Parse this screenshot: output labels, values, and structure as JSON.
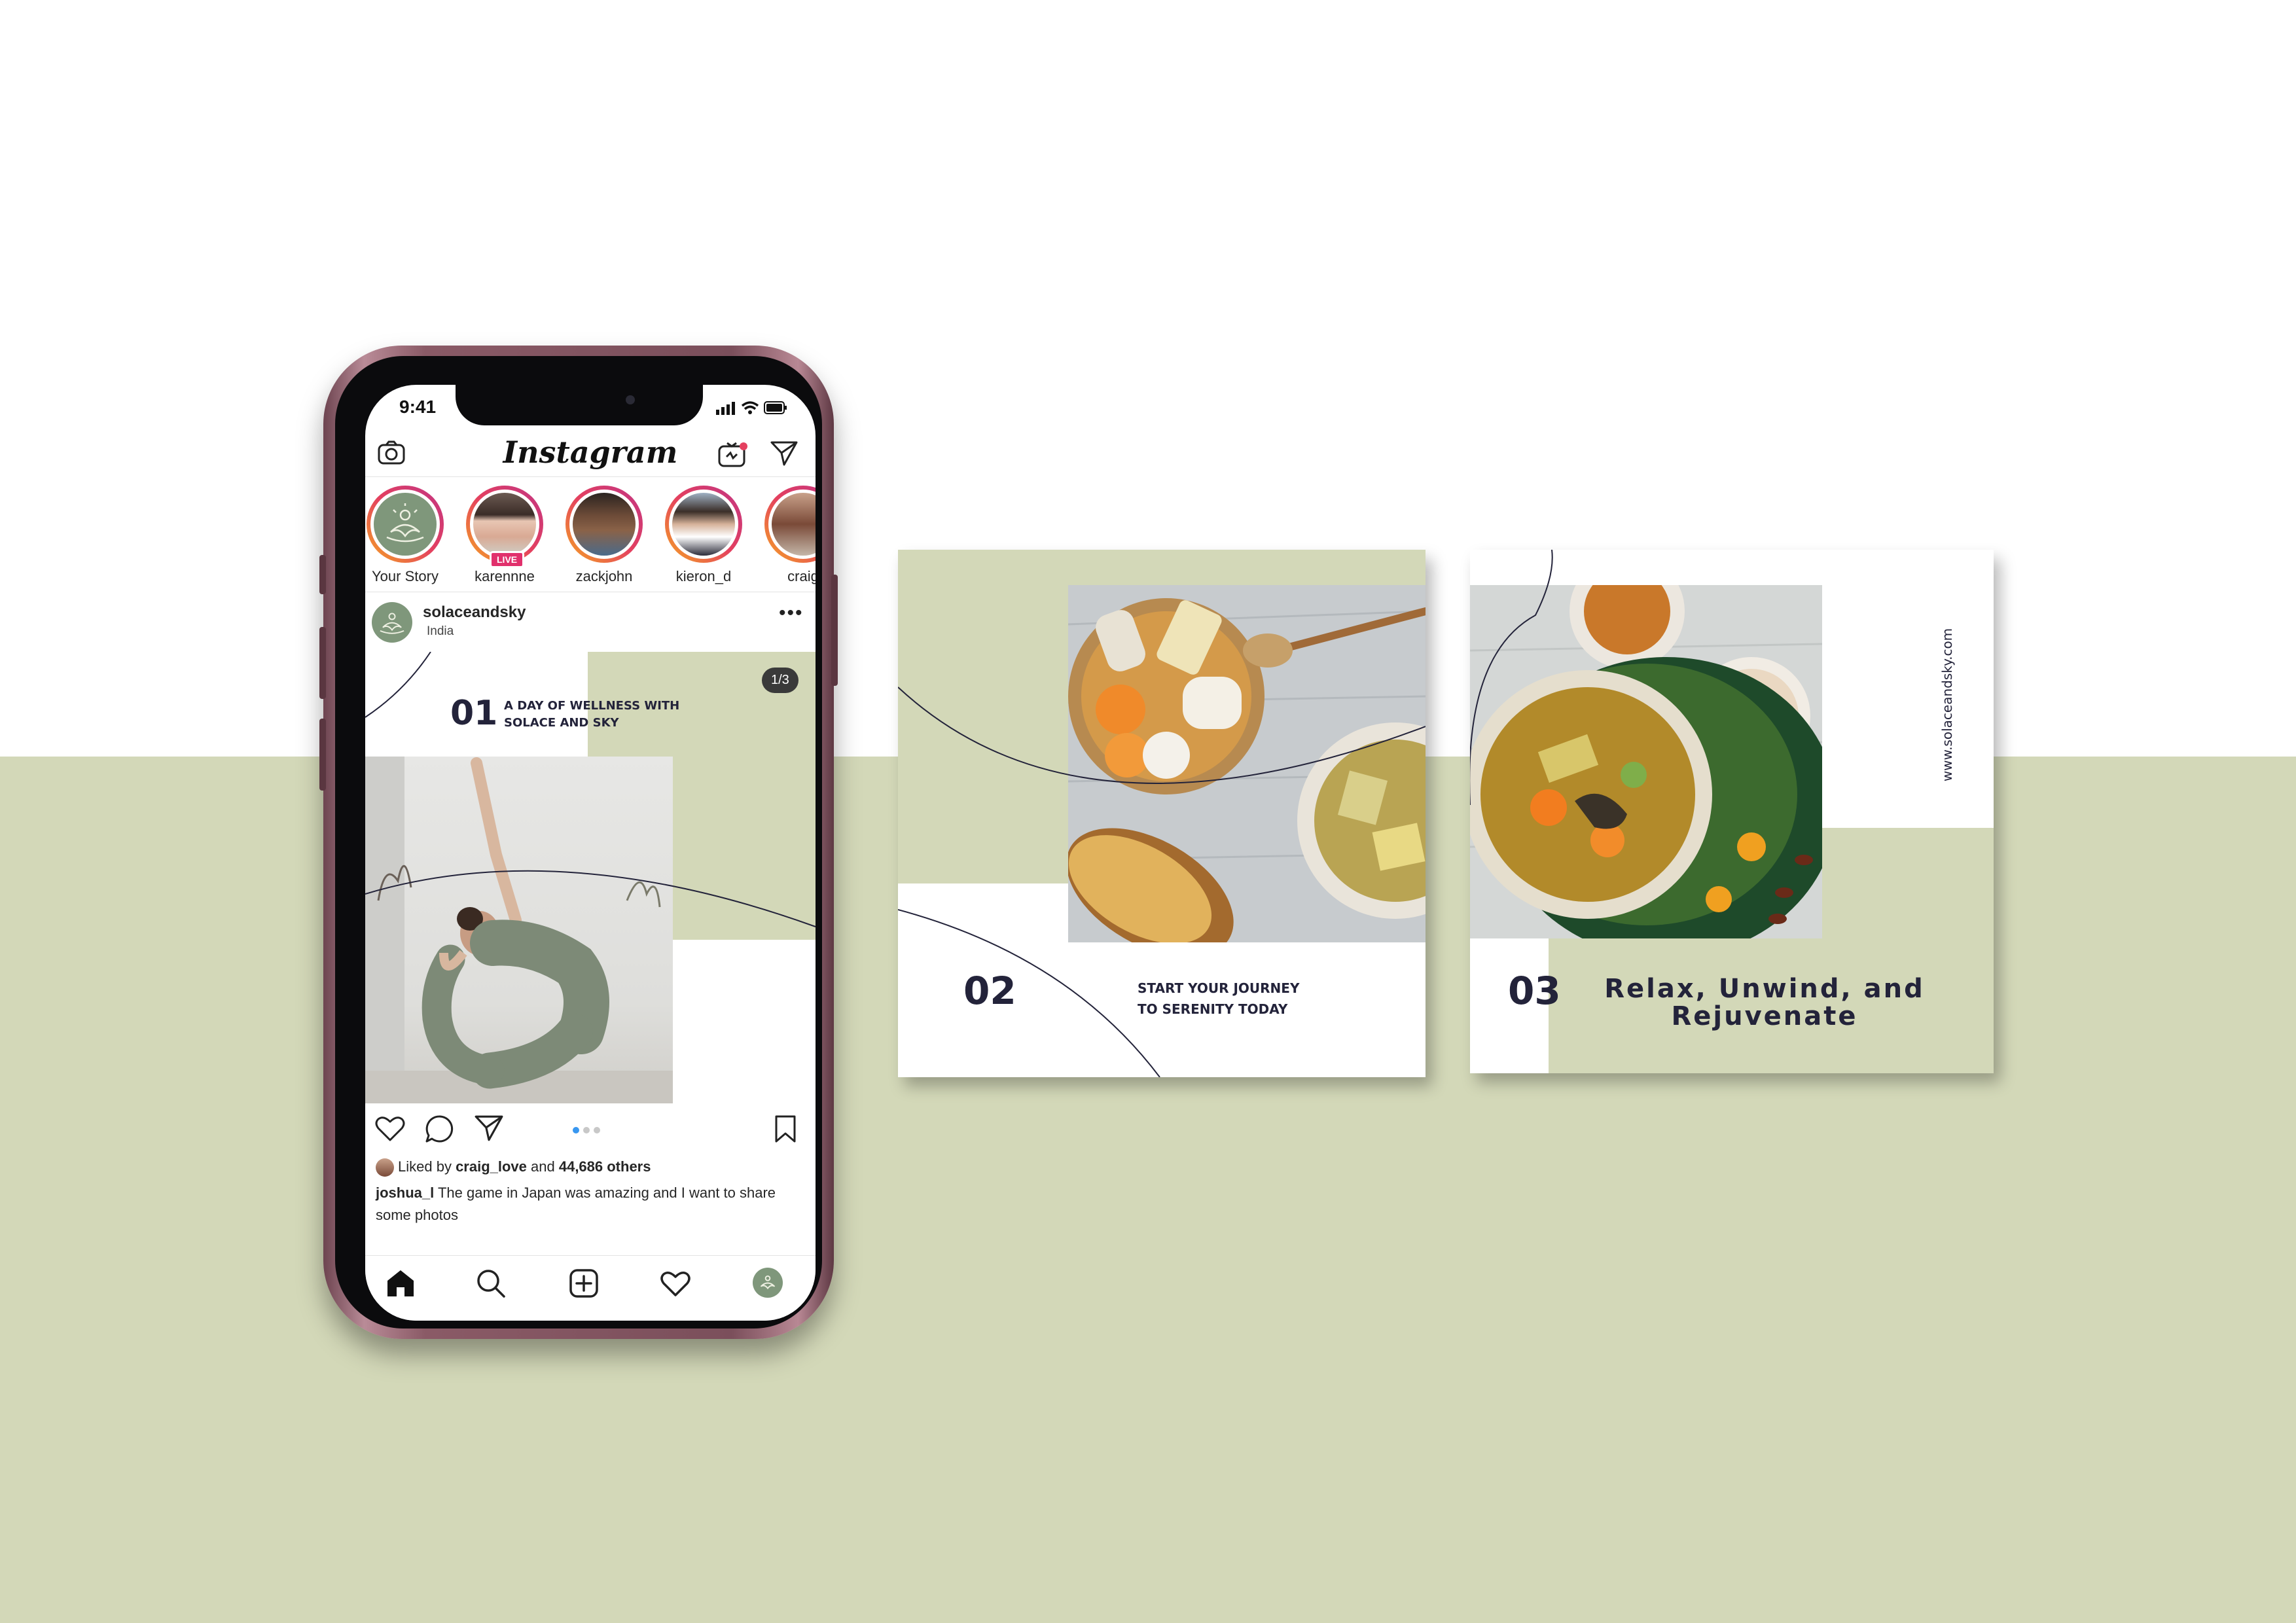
{
  "colors": {
    "sage": "#d3d8b8",
    "dark_navy": "#23233a",
    "phone_frame": "#7b4f5b",
    "ig_gradient_start": "#f5a623",
    "ig_gradient_end": "#c13584"
  },
  "status_bar": {
    "time": "9:41"
  },
  "instagram": {
    "logo": "Instagram",
    "header_icons": [
      "camera-icon",
      "igtv-icon",
      "direct-message-icon"
    ],
    "stories": [
      {
        "label": "Your Story"
      },
      {
        "label": "karennne",
        "badge": "LIVE"
      },
      {
        "label": "zackjohn"
      },
      {
        "label": "kieron_d"
      },
      {
        "label": "craig"
      }
    ],
    "post": {
      "username": "solaceandsky",
      "location": "India",
      "more": "•••",
      "counter": "1/3",
      "slide_number": "01",
      "slide_title_line1": "A DAY OF WELLNESS WITH",
      "slide_title_line2": "SOLACE AND SKY",
      "liked_prefix": "Liked by ",
      "liked_user": "craig_love",
      "liked_mid": " and ",
      "liked_count": "44,686 others",
      "caption_user": "joshua_l",
      "caption_text": " The game in Japan was amazing and I want to share some photos",
      "carousel_dots": 3,
      "carousel_active": 1
    },
    "tabs": [
      "home-icon",
      "search-icon",
      "add-post-icon",
      "activity-heart-icon",
      "profile-icon"
    ]
  },
  "cards": [
    {
      "number": "02",
      "line1": "START YOUR JOURNEY",
      "line2": "TO SERENITY TODAY"
    },
    {
      "number": "03",
      "line1": "Relax, Unwind, and",
      "line2": "Rejuvenate",
      "website": "www.solaceandsky.com"
    }
  ]
}
